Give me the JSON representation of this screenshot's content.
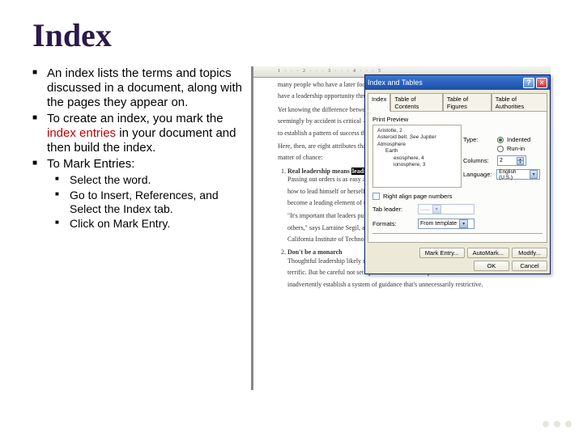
{
  "title": "Index",
  "bullets": {
    "b1": "An index lists the terms and topics discussed in a document, along with the pages they appear on.",
    "b2a": "To create an index, you mark the ",
    "b2b": "index entries",
    "b2c": " in your document and then build the index.",
    "b3": "To Mark Entries:",
    "sub1": "Select the word.",
    "sub2": "Go to Insert, References, and Select the Index tab.",
    "sub3": "Click on Mark Entry."
  },
  "doc": {
    "l1": "many people who have a later focus on ge...",
    "l2": "have a leadership opportunity thrust upon th...",
    "l3": "Yet knowing the difference between though...",
    "l4": "seemingly by accident is critical — not only...",
    "l5": "to establish a pattern of success that's delibe...",
    "l6": "Here, then, are eight attributes that separate...",
    "l7": "matter of chance:",
    "li1a": "Real leadership means ",
    "li1sel": "leading",
    "li1b": " yourse...",
    "li1_1": "Passing out orders is as easy as passing o...",
    "li1_2": "how to lead himself or herself — not me...",
    "li1_3": "become a leading element of the overall...",
    "li1_4": "\"It's important that leaders put themselves...",
    "li1_5": "others,\" says Larraine Segil, an author an...",
    "li1_6": "California Institute of Technology in Pas...",
    "li2": "Don't be a monarch",
    "li2_1": "Thoughtful leadership likely means you g...",
    "li2_2": "terrific. But be careful not set up a throne room in the process. Accidental leaders often",
    "li2_3": "inadvertently establish a system of guidance that's unnecessarily restrictive."
  },
  "dialog": {
    "title": "Index and Tables",
    "tabs": {
      "index": "Index",
      "toc": "Table of Contents",
      "tof": "Table of Figures",
      "toa": "Table of Authorities"
    },
    "print_preview": "Print Preview",
    "preview": {
      "p1": "Aristotle, 2",
      "p2a": "Asteroid belt. ",
      "p2b": "See",
      "p2c": " Jupiter",
      "p3": "Atmosphere",
      "p4": "Earth",
      "p5": "exosphere, 4",
      "p6": "ionosphere, 3"
    },
    "type_label": "Type:",
    "type_indented": "Indented",
    "type_runin": "Run-in",
    "columns_label": "Columns:",
    "columns_value": "2",
    "language_label": "Language:",
    "language_value": "English (U.S.)",
    "right_align": "Right align page numbers",
    "tab_leader": "Tab leader:",
    "tab_leader_value": "......",
    "formats": "Formats:",
    "formats_value": "From template",
    "mark_entry": "Mark Entry...",
    "automark": "AutoMark...",
    "modify": "Modify...",
    "ok": "OK",
    "cancel": "Cancel"
  }
}
